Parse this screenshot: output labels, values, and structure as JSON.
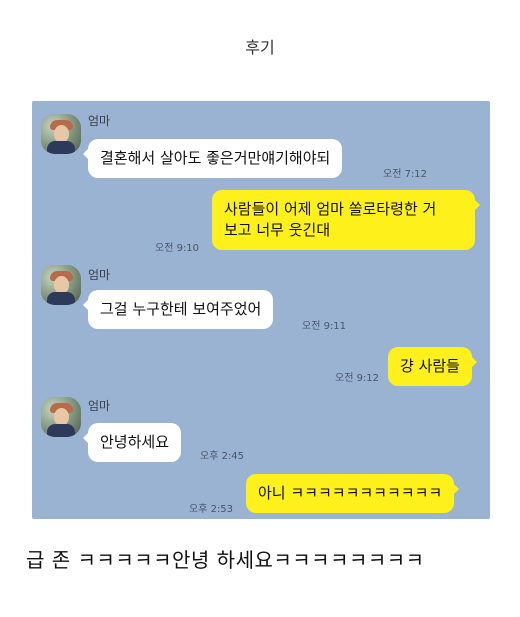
{
  "page": {
    "title": "후기",
    "caption": "급 존   ㅋㅋㅋㅋㅋ안녕 하세요ㅋㅋㅋㅋㅋㅋㅋㅋ"
  },
  "chat": {
    "sender_name": "엄마",
    "messages": [
      {
        "direction": "in",
        "text": "결혼해서 살아도  좋은거만얘기해야되",
        "time": "오전 7:12"
      },
      {
        "direction": "out",
        "lines": [
          "사람들이 어제 엄마 쏠로타령한 거",
          "보고 너무 웃긴대"
        ],
        "time": "오전 9:10"
      },
      {
        "direction": "in",
        "text": "그걸 누구한테 보여주었어",
        "time": "오전 9:11"
      },
      {
        "direction": "out",
        "text": "걍 사람들",
        "time": "오전 9:12"
      },
      {
        "direction": "in",
        "text": "안녕하세요",
        "time": "오후 2:45"
      },
      {
        "direction": "out",
        "text": "아니 ㅋㅋㅋㅋㅋㅋㅋㅋㅋㅋㅋ",
        "time": "오후 2:53"
      }
    ]
  },
  "colors": {
    "chat_background": "#9bb3d2",
    "incoming_bubble": "#ffffff",
    "outgoing_bubble": "#fef01b"
  },
  "icons": {
    "avatar": "mom-profile-photo"
  }
}
